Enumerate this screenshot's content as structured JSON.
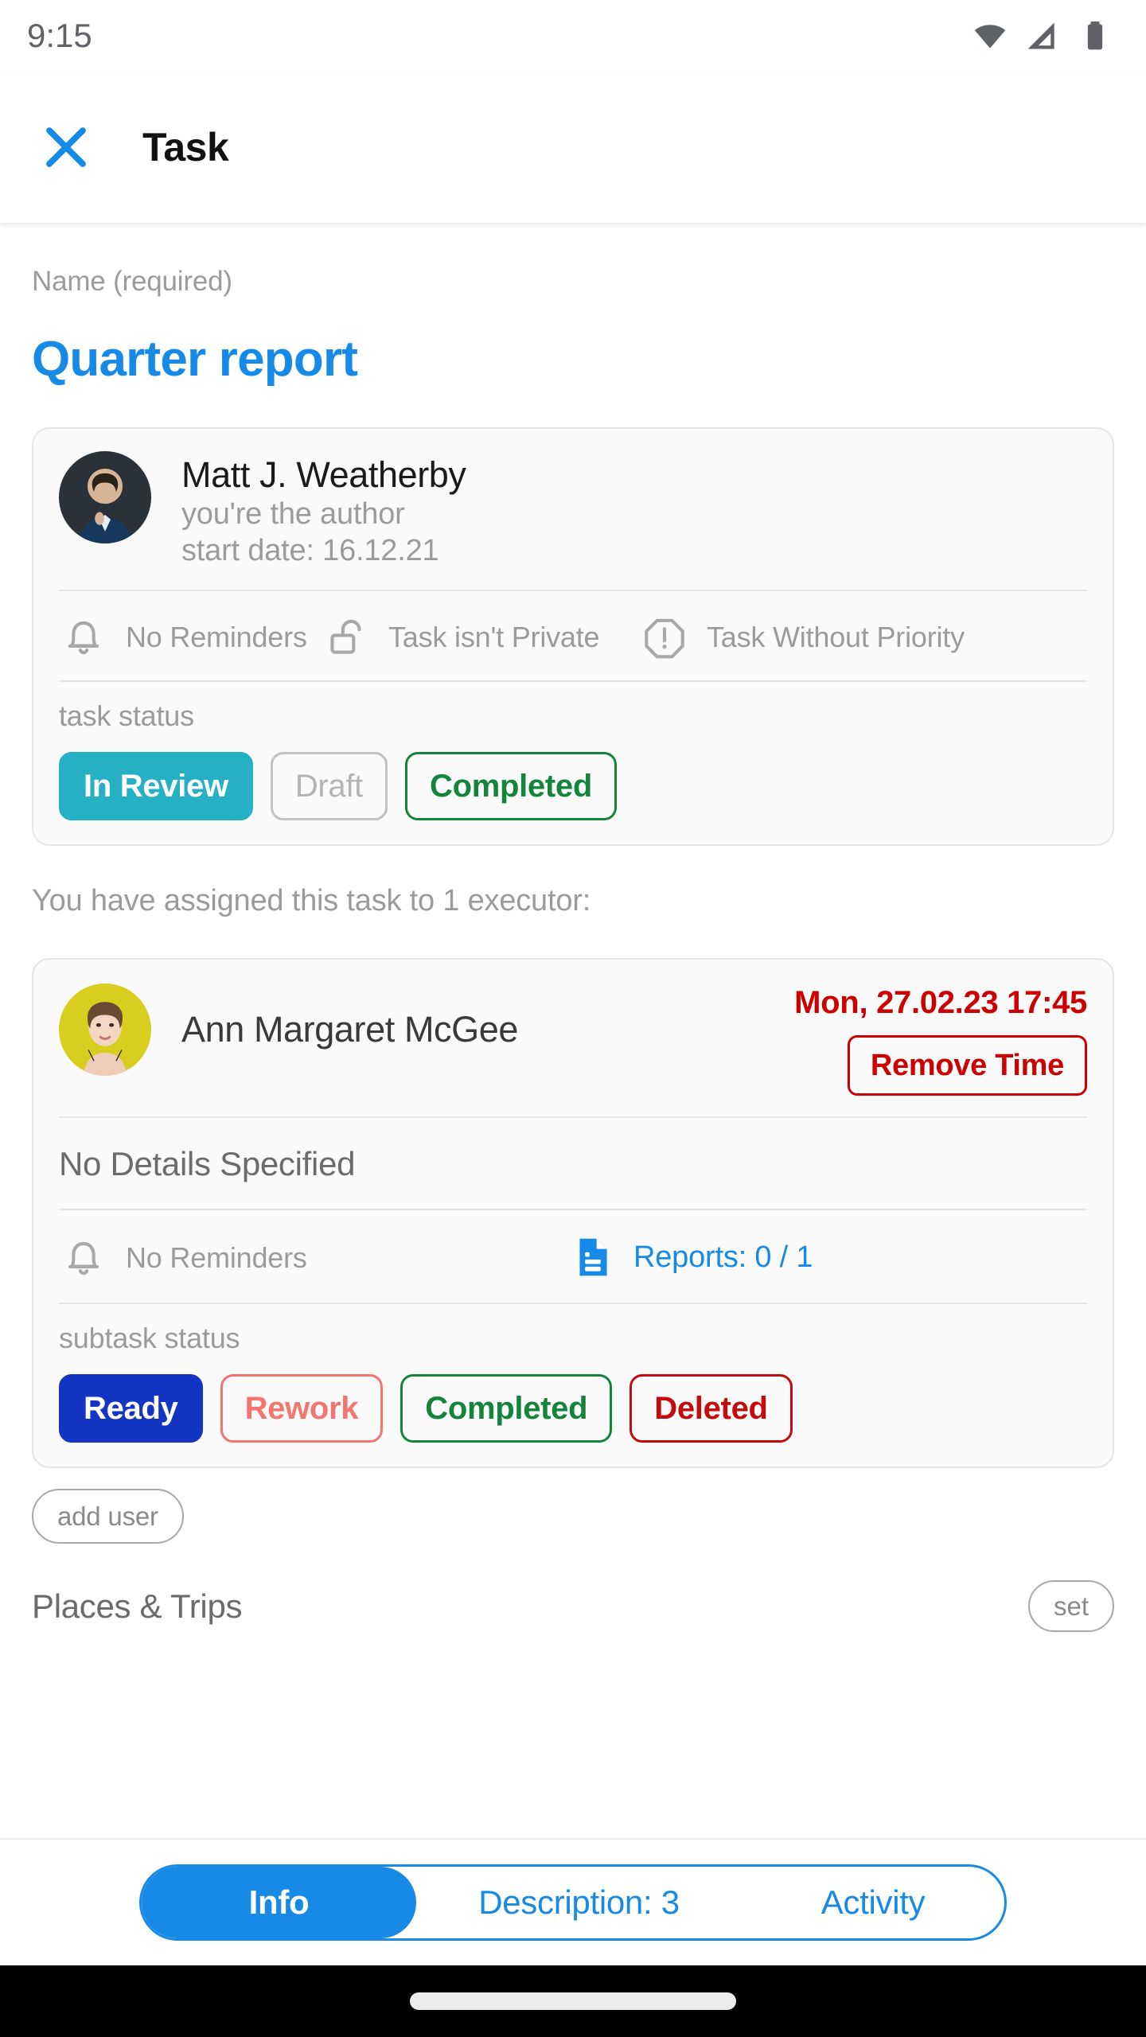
{
  "status_bar": {
    "time": "9:15",
    "icons": [
      "wifi-icon",
      "cell-signal-icon",
      "battery-icon"
    ]
  },
  "app_bar": {
    "close_icon": "close-icon",
    "title": "Task"
  },
  "name_field": {
    "label": "Name (required)",
    "value": "Quarter report"
  },
  "author_card": {
    "avatar": "author-avatar",
    "name": "Matt J. Weatherby",
    "role": "you're the author",
    "start_date": "start date: 16.12.21",
    "attributes": [
      {
        "icon": "bell-icon",
        "label": "No Reminders"
      },
      {
        "icon": "unlock-icon",
        "label": "Task isn't Private"
      },
      {
        "icon": "priority-octagon-icon",
        "label": "Task Without Priority"
      }
    ],
    "status_label": "task status",
    "statuses": [
      {
        "label": "In Review",
        "style": "teal-filled"
      },
      {
        "label": "Draft",
        "style": "gray-outline"
      },
      {
        "label": "Completed",
        "style": "green-outline"
      }
    ]
  },
  "executor_note": "You have assigned this task to 1 executor:",
  "executor_card": {
    "avatar": "executor-avatar",
    "name": "Ann Margaret McGee",
    "due_date": "Mon, 27.02.23 17:45",
    "remove_time_label": "Remove Time",
    "details": "No Details Specified",
    "reminders": {
      "icon": "bell-icon",
      "label": "No Reminders"
    },
    "reports": {
      "icon": "document-icon",
      "label": "Reports: 0 / 1"
    },
    "status_label": "subtask status",
    "statuses": [
      {
        "label": "Ready",
        "style": "blue-filled"
      },
      {
        "label": "Rework",
        "style": "salmon-outline"
      },
      {
        "label": "Completed",
        "style": "green-outline"
      },
      {
        "label": "Deleted",
        "style": "red-outline"
      }
    ]
  },
  "add_user_label": "add user",
  "cut_off_row": {
    "title": "Places & Trips",
    "action_label": "set"
  },
  "tabbar": {
    "tabs": [
      {
        "label": "Info",
        "active": true
      },
      {
        "label": "Description: 3",
        "active": false
      },
      {
        "label": "Activity",
        "active": false
      }
    ]
  },
  "colors": {
    "accent_blue": "#1789e6",
    "teal": "#25b0c4",
    "green": "#13843a",
    "red": "#cc0000",
    "dark_blue": "#1434c4",
    "salmon": "#f4756e",
    "deep_red": "#c50b0b",
    "muted_gray": "#9b9b9b"
  }
}
